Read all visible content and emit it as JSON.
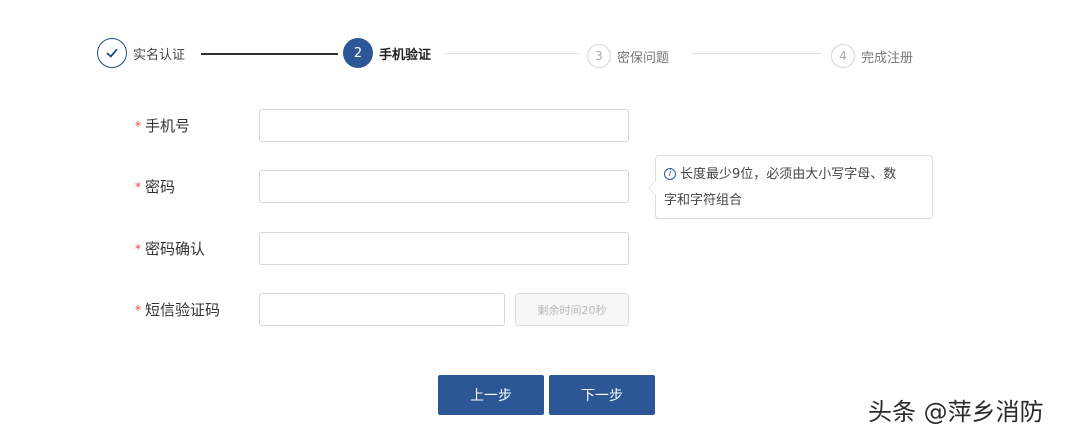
{
  "steps": [
    {
      "label": "实名认证",
      "status": "done",
      "icon": "check-icon"
    },
    {
      "number": "2",
      "label": "手机验证",
      "status": "active"
    },
    {
      "number": "3",
      "label": "密保问题",
      "status": "todo"
    },
    {
      "number": "4",
      "label": "完成注册",
      "status": "todo"
    }
  ],
  "form": {
    "required_mark": "*",
    "phone_label": "手机号",
    "phone_value": "",
    "password_label": "密码",
    "password_value": "",
    "confirm_label": "密码确认",
    "confirm_value": "",
    "sms_label": "短信验证码",
    "sms_value": "",
    "sms_button": "剩余时间20秒"
  },
  "tooltip": {
    "icon": "info-icon",
    "line1": "长度最少9位，必须由大小写字母、数",
    "line2": "字和字符组合"
  },
  "buttons": {
    "prev": "上一步",
    "next": "下一步"
  },
  "watermark": "头条 @萍乡消防",
  "colors": {
    "primary": "#2c5695",
    "required": "#e2473b",
    "border": "#d5d5d5"
  }
}
